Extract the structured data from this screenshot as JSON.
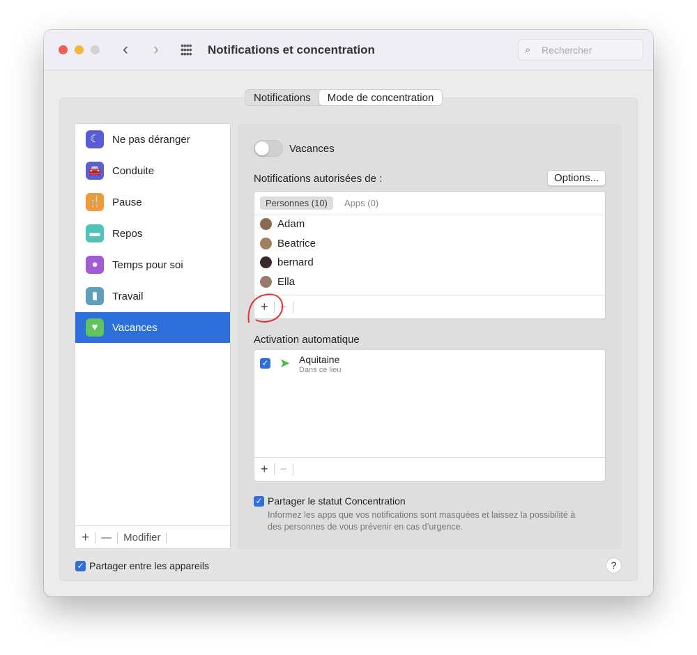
{
  "window": {
    "title": "Notifications et concentration",
    "search_placeholder": "Rechercher"
  },
  "tabs": [
    {
      "label": "Notifications",
      "selected": false
    },
    {
      "label": "Mode de concentration",
      "selected": true
    }
  ],
  "sidebar": {
    "items": [
      {
        "label": "Ne pas déranger",
        "icon": "moon-icon",
        "color": "#5b5bd6"
      },
      {
        "label": "Conduite",
        "icon": "car-icon",
        "color": "#5b5fd0"
      },
      {
        "label": "Pause",
        "icon": "fork-knife-icon",
        "color": "#f09a37"
      },
      {
        "label": "Repos",
        "icon": "bed-icon",
        "color": "#4fc3b8"
      },
      {
        "label": "Temps pour soi",
        "icon": "person-icon",
        "color": "#a35ad6"
      },
      {
        "label": "Travail",
        "icon": "badge-icon",
        "color": "#5f9fb7"
      },
      {
        "label": "Vacances",
        "icon": "heart-icon",
        "color": "#5ec45e",
        "selected": true
      }
    ],
    "add": "+",
    "remove": "—",
    "modify": "Modifier"
  },
  "detail": {
    "focus_name": "Vacances",
    "toggle_on": false,
    "allowed_label": "Notifications autorisées de :",
    "options_label": "Options...",
    "subtabs": [
      "Personnes (10)",
      "Apps (0)"
    ],
    "people": [
      "Adam",
      "Beatrice",
      "bernard",
      "Ella"
    ],
    "auto_label": "Activation automatique",
    "auto_items": [
      {
        "title": "Aquitaine",
        "subtitle": "Dans ce lieu",
        "checked": true
      }
    ],
    "share_label": "Partager le statut Concentration",
    "share_checked": true,
    "share_desc": "Informez les apps que vos notifications sont masquées et laissez la possibilité à des personnes de vous prévenir en cas d’urgence."
  },
  "footer": {
    "share_devices": "Partager entre les appareils",
    "share_devices_checked": true,
    "help": "?"
  },
  "accent": "#2e6fdb"
}
